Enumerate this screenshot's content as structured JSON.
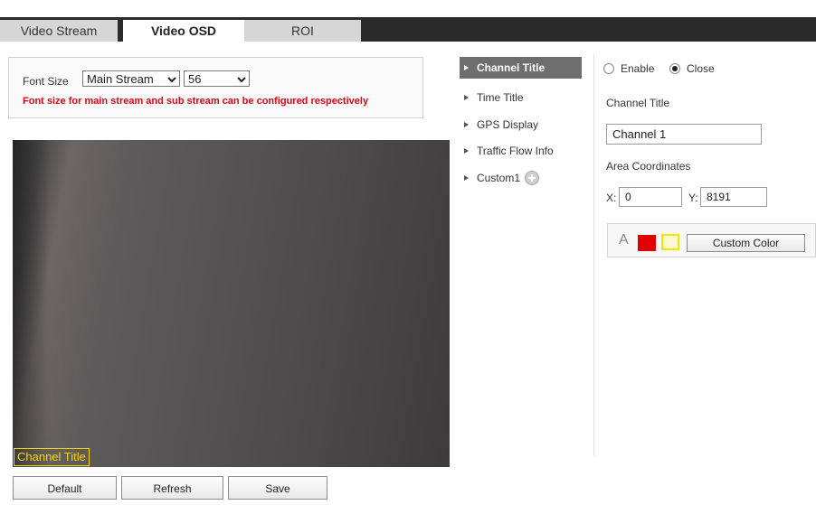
{
  "tabs": [
    {
      "label": "Video Stream",
      "active": false
    },
    {
      "label": "Video OSD",
      "active": true
    },
    {
      "label": "ROI",
      "active": false
    }
  ],
  "font_size": {
    "label": "Font Size",
    "stream_value": "Main Stream",
    "size_value": "56",
    "hint": "Font size for main stream and sub stream can be configured respectively"
  },
  "video": {
    "osd_overlay_text": "Channel Title"
  },
  "buttons": {
    "default_label": "Default",
    "refresh_label": "Refresh",
    "save_label": "Save"
  },
  "menu": [
    {
      "label": "Channel Title",
      "active": true
    },
    {
      "label": "Time Title",
      "active": false
    },
    {
      "label": "GPS Display",
      "active": false
    },
    {
      "label": "Traffic Flow Info",
      "active": false
    },
    {
      "label": "Custom1",
      "active": false
    }
  ],
  "panel": {
    "enable_label": "Enable",
    "close_label": "Close",
    "selected": "Close",
    "channel_title_label": "Channel Title",
    "channel_title_value": "Channel 1",
    "area_label": "Area Coordinates",
    "x_label": "X:",
    "x_value": "0",
    "y_label": "Y:",
    "y_value": "8191",
    "color_glyph": "A",
    "custom_color_label": "Custom Color"
  },
  "colors": {
    "accent_red": "#e60012",
    "osd_yellow": "#ffd400",
    "swatch_red": "#e00000",
    "swatch_yellow_bg": "#fff7cf"
  }
}
